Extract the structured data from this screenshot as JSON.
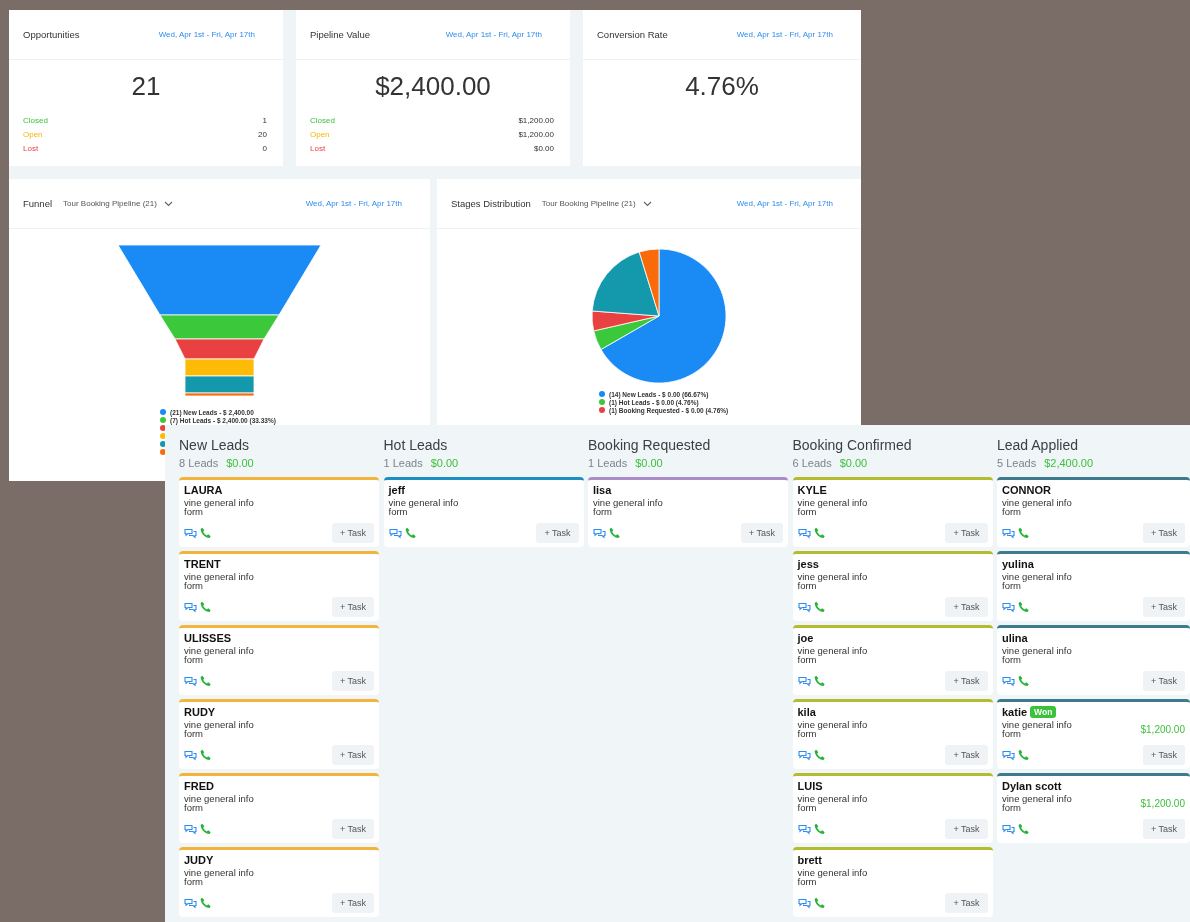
{
  "stats": [
    {
      "title": "Opportunities",
      "date_range": "Wed, Apr 1st - Fri, Apr 17th",
      "value": "21",
      "rows": [
        {
          "kind": "closed",
          "label": "Closed",
          "value": "1"
        },
        {
          "kind": "open",
          "label": "Open",
          "value": "20"
        },
        {
          "kind": "lost",
          "label": "Lost",
          "value": "0"
        }
      ]
    },
    {
      "title": "Pipeline Value",
      "date_range": "Wed, Apr 1st - Fri, Apr 17th",
      "value": "$2,400.00",
      "rows": [
        {
          "kind": "closed",
          "label": "Closed",
          "value": "$1,200.00"
        },
        {
          "kind": "open",
          "label": "Open",
          "value": "$1,200.00"
        },
        {
          "kind": "lost",
          "label": "Lost",
          "value": "$0.00"
        }
      ]
    },
    {
      "title": "Conversion Rate",
      "date_range": "Wed, Apr 1st - Fri, Apr 17th",
      "value": "4.76%"
    }
  ],
  "charts": [
    {
      "kind": "funnel",
      "title": "Funnel",
      "pipeline": "Tour Booking Pipeline (21)",
      "date_range": "Wed, Apr 1st - Fri, Apr 17th",
      "legend": [
        {
          "label": "(21) New Leads - $ 2,400.00",
          "color": "#1a8af4"
        },
        {
          "label": "(7) Hot Leads - $ 2,400.00 (33.33%)",
          "color": "#3bc93b"
        },
        {
          "color": "#e94141"
        },
        {
          "color": "#fdbb06"
        },
        {
          "color": "#1498ab"
        },
        {
          "color": "#f96a0a"
        }
      ]
    },
    {
      "kind": "pie",
      "title": "Stages Distribution",
      "pipeline": "Tour Booking Pipeline (21)",
      "date_range": "Wed, Apr 1st - Fri, Apr 17th",
      "legend": [
        {
          "label": "(14) New Leads - $ 0.00 (66.67%)",
          "color": "#1a8af4"
        },
        {
          "label": "(1) Hot Leads - $ 0.00 (4.76%)",
          "color": "#3bc93b"
        },
        {
          "label": "(1) Booking Requested - $ 0.00 (4.76%)",
          "color": "#e94141"
        }
      ]
    }
  ],
  "board": {
    "columns": [
      {
        "title": "New Leads",
        "count": "8 Leads",
        "amount": "$0.00",
        "color": "#f3b43c",
        "cards": [
          {
            "name": "LAURA",
            "source": "vine general info form",
            "action": "+ Task"
          },
          {
            "name": "TRENT",
            "source": "vine general info form",
            "action": "+ Task"
          },
          {
            "name": "ULISSES",
            "source": "vine general info form",
            "action": "+ Task"
          },
          {
            "name": "RUDY",
            "source": "vine general info form",
            "action": "+ Task"
          },
          {
            "name": "FRED",
            "source": "vine general info form",
            "action": "+ Task"
          },
          {
            "name": "JUDY",
            "source": "vine general info form",
            "action": "+ Task"
          }
        ]
      },
      {
        "title": "Hot Leads",
        "count": "1 Leads",
        "amount": "$0.00",
        "color": "#1c8fc2",
        "cards": [
          {
            "name": "jeff",
            "source": "vine general info form",
            "action": "+ Task"
          }
        ]
      },
      {
        "title": "Booking Requested",
        "count": "1 Leads",
        "amount": "$0.00",
        "color": "#a98cc8",
        "cards": [
          {
            "name": "lisa",
            "source": "vine general info form",
            "action": "+ Task"
          }
        ]
      },
      {
        "title": "Booking Confirmed",
        "count": "6 Leads",
        "amount": "$0.00",
        "color": "#b3bc2f",
        "cards": [
          {
            "name": "KYLE",
            "source": "vine general info form",
            "action": "+ Task"
          },
          {
            "name": "jess",
            "source": "vine general info form",
            "action": "+ Task"
          },
          {
            "name": "joe",
            "source": "vine general info form",
            "action": "+ Task"
          },
          {
            "name": "kila",
            "source": "vine general info form",
            "action": "+ Task"
          },
          {
            "name": "LUIS",
            "source": "vine general info form",
            "action": "+ Task"
          },
          {
            "name": "brett",
            "source": "vine general info form",
            "action": "+ Task"
          }
        ]
      },
      {
        "title": "Lead Applied",
        "count": "5 Leads",
        "amount": "$2,400.00",
        "color": "#3d7a8e",
        "cards": [
          {
            "name": "CONNOR",
            "source": "vine general info form",
            "action": "+ Task"
          },
          {
            "name": "yulina",
            "source": "vine general info form",
            "action": "+ Task"
          },
          {
            "name": "ulina",
            "source": "vine general info form",
            "action": "+ Task"
          },
          {
            "name": "katie",
            "badge": "Won",
            "source": "vine general info form",
            "value": "$1,200.00",
            "action": "+ Task"
          },
          {
            "name": "Dylan scott",
            "source": "vine general info form",
            "value": "$1,200.00",
            "action": "+ Task"
          }
        ]
      }
    ]
  }
}
